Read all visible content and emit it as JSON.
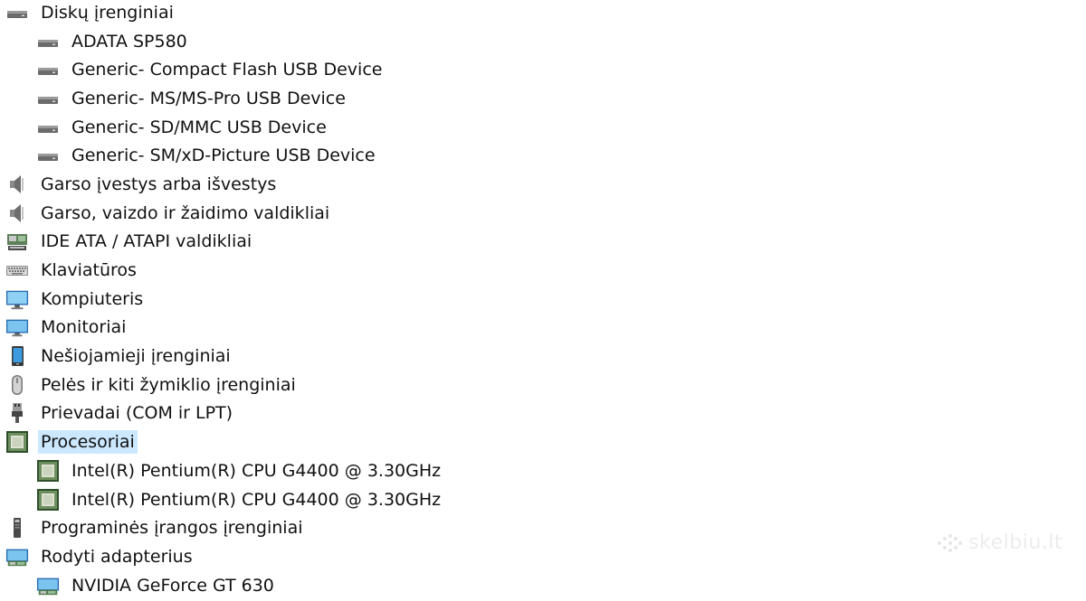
{
  "tree": [
    {
      "label": "Diskų įrenginiai",
      "level": 0,
      "icon": "drive-icon",
      "selected": false
    },
    {
      "label": "ADATA SP580",
      "level": 1,
      "icon": "drive-icon",
      "selected": false
    },
    {
      "label": "Generic- Compact Flash USB Device",
      "level": 1,
      "icon": "drive-icon",
      "selected": false
    },
    {
      "label": "Generic- MS/MS-Pro USB Device",
      "level": 1,
      "icon": "drive-icon",
      "selected": false
    },
    {
      "label": "Generic- SD/MMC USB Device",
      "level": 1,
      "icon": "drive-icon",
      "selected": false
    },
    {
      "label": "Generic- SM/xD-Picture USB Device",
      "level": 1,
      "icon": "drive-icon",
      "selected": false
    },
    {
      "label": "Garso įvestys arba išvestys",
      "level": 0,
      "icon": "speaker-icon",
      "selected": false
    },
    {
      "label": "Garso, vaizdo ir žaidimo valdikliai",
      "level": 0,
      "icon": "speaker-icon",
      "selected": false
    },
    {
      "label": "IDE ATA / ATAPI valdikliai",
      "level": 0,
      "icon": "ide-controller-icon",
      "selected": false
    },
    {
      "label": "Klaviatūros",
      "level": 0,
      "icon": "keyboard-icon",
      "selected": false
    },
    {
      "label": "Kompiuteris",
      "level": 0,
      "icon": "computer-icon",
      "selected": false
    },
    {
      "label": "Monitoriai",
      "level": 0,
      "icon": "monitor-icon",
      "selected": false
    },
    {
      "label": "Nešiojamieji įrenginiai",
      "level": 0,
      "icon": "portable-device-icon",
      "selected": false
    },
    {
      "label": "Pelės ir kiti žymiklio įrenginiai",
      "level": 0,
      "icon": "mouse-icon",
      "selected": false
    },
    {
      "label": "Prievadai (COM ir LPT)",
      "level": 0,
      "icon": "port-icon",
      "selected": false
    },
    {
      "label": "Procesoriai",
      "level": 0,
      "icon": "processor-icon",
      "selected": true
    },
    {
      "label": "Intel(R) Pentium(R) CPU G4400 @ 3.30GHz",
      "level": 1,
      "icon": "processor-icon",
      "selected": false
    },
    {
      "label": "Intel(R) Pentium(R) CPU G4400 @ 3.30GHz",
      "level": 1,
      "icon": "processor-icon",
      "selected": false
    },
    {
      "label": "Programinės įrangos įrenginiai",
      "level": 0,
      "icon": "software-device-icon",
      "selected": false
    },
    {
      "label": "Rodyti adapterius",
      "level": 0,
      "icon": "display-adapter-icon",
      "selected": false
    },
    {
      "label": "NVIDIA GeForce GT 630",
      "level": 1,
      "icon": "display-adapter-icon",
      "selected": false
    }
  ],
  "watermark": "skelbiu.lt",
  "colors": {
    "selection": "#cce8ff",
    "monitor_blue": "#2f8fd8",
    "chip_green": "#3e6b3a"
  }
}
